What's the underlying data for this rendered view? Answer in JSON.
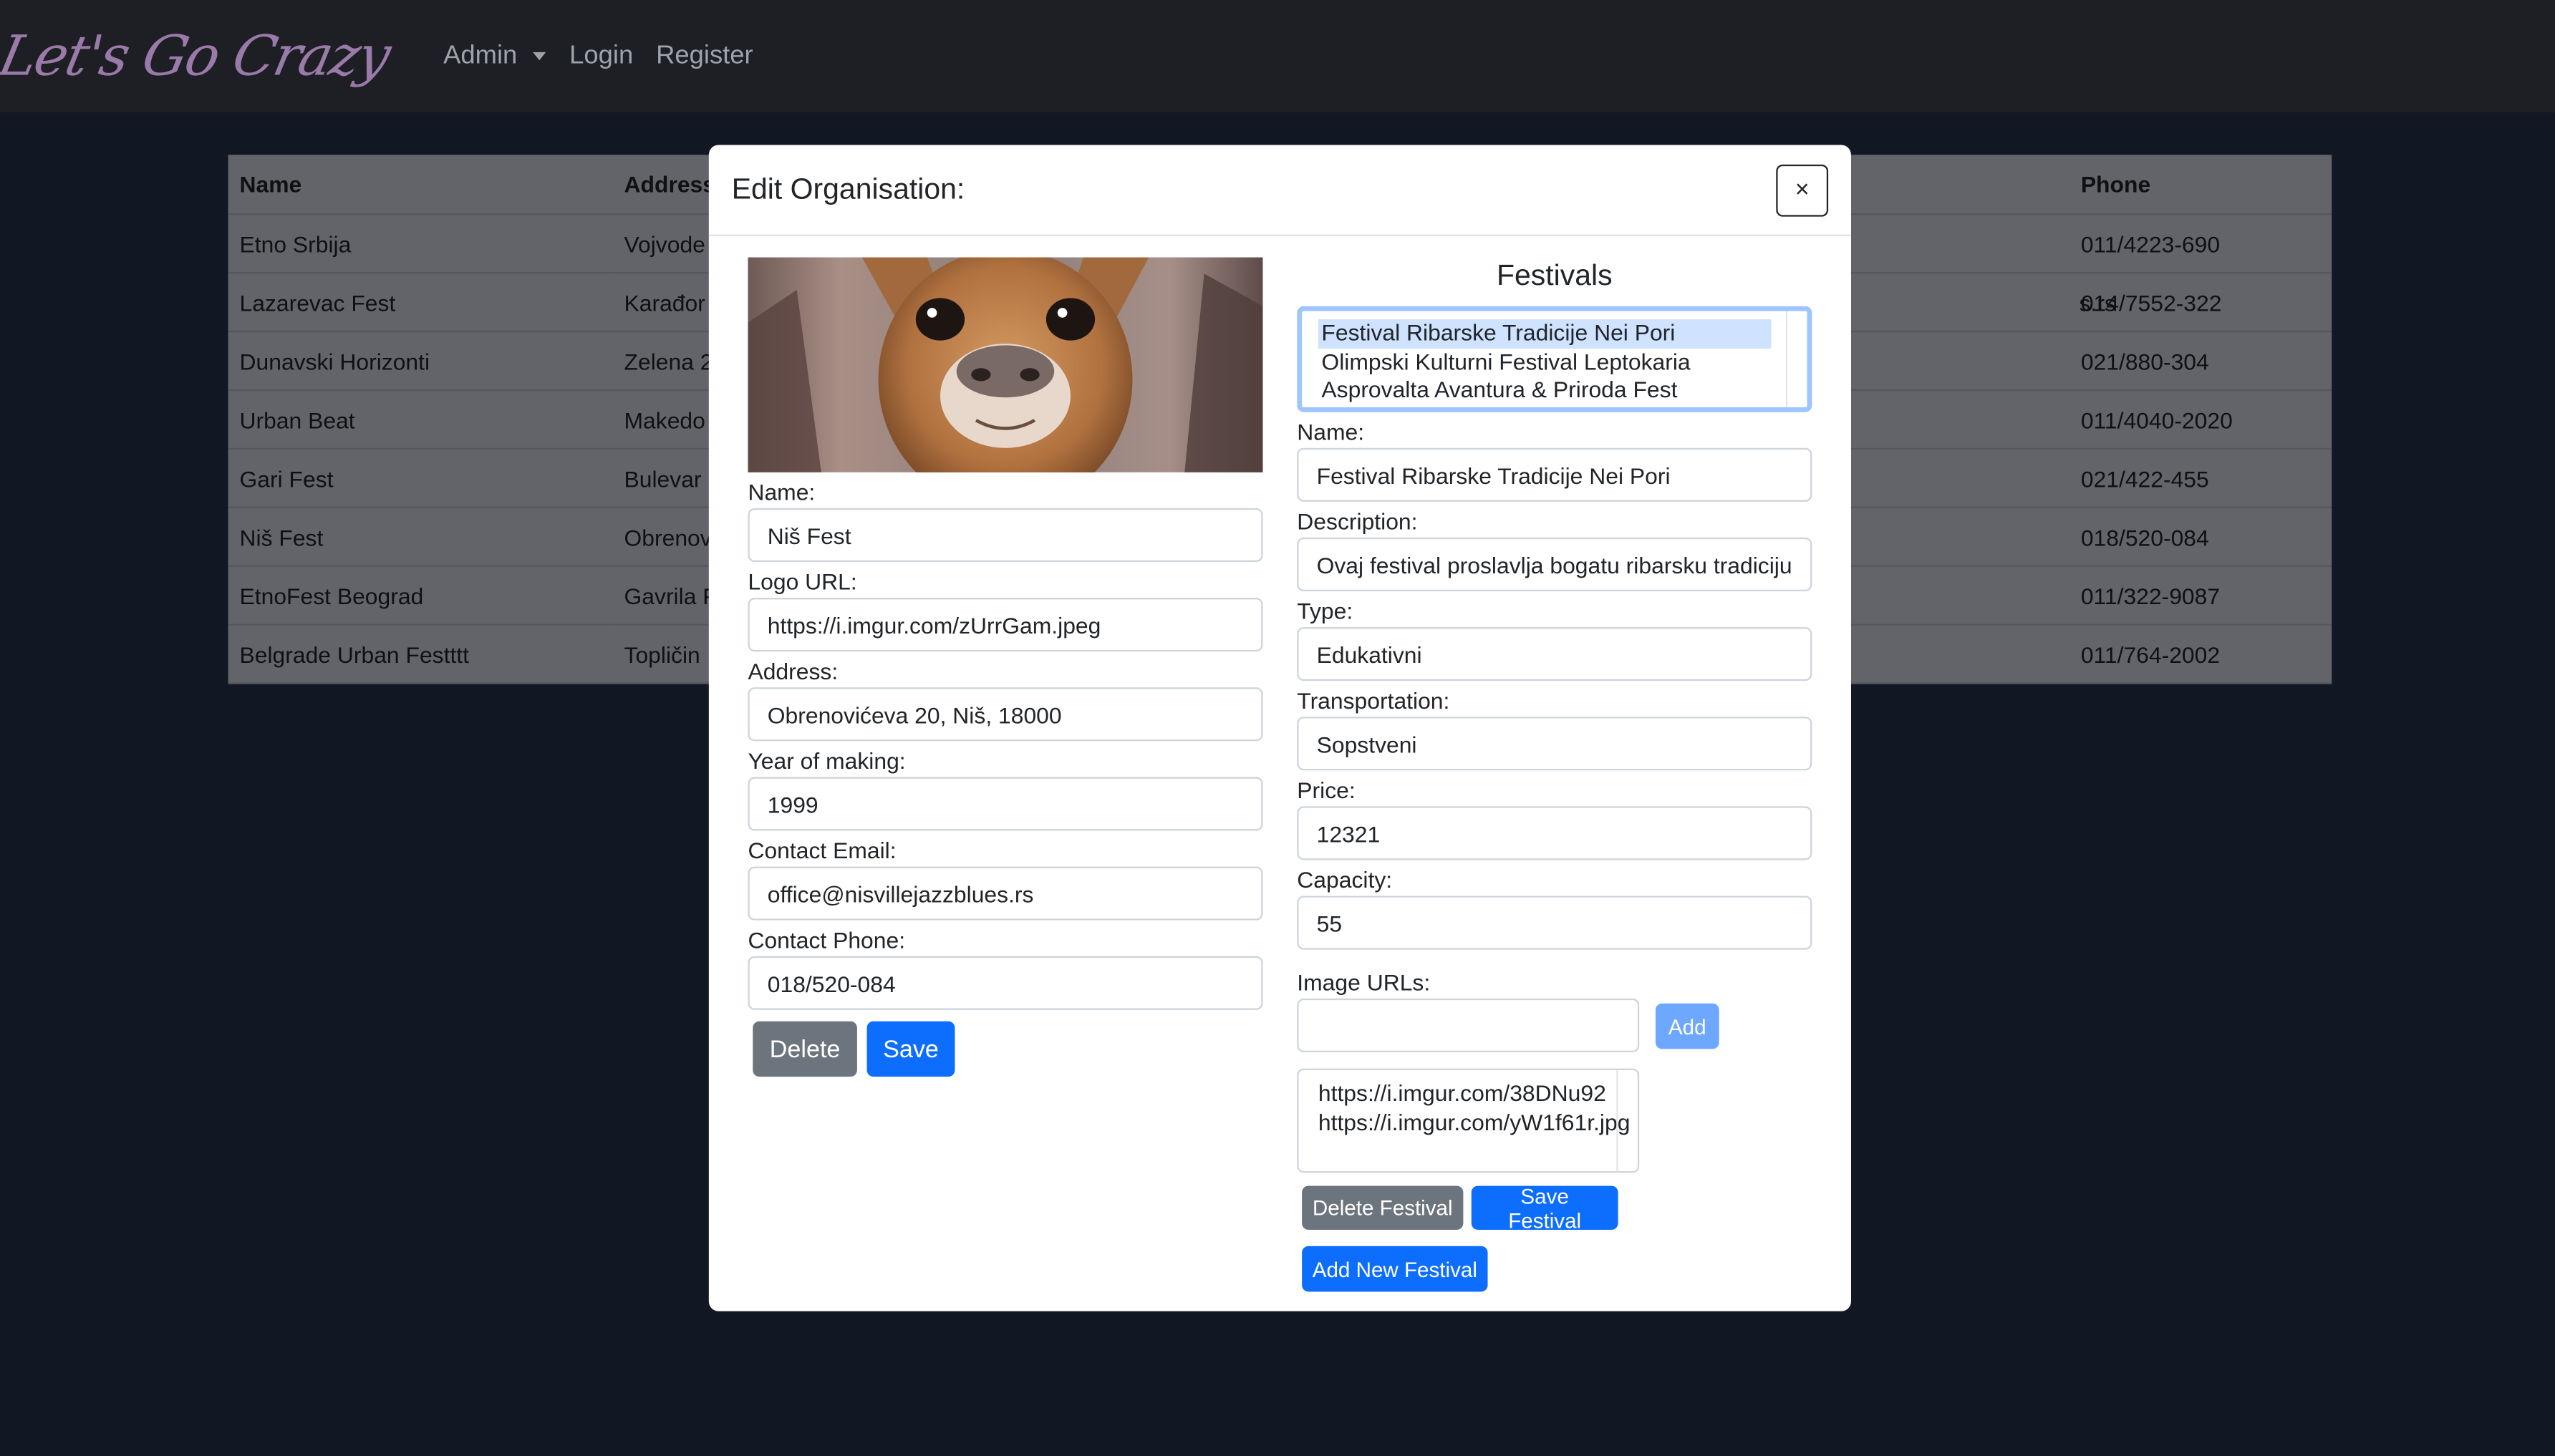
{
  "navbar": {
    "brand": "Let's Go Crazy",
    "admin_label": "Admin",
    "login_label": "Login",
    "register_label": "Register"
  },
  "table": {
    "headers": [
      "Name",
      "Address",
      "Phone"
    ],
    "rows": [
      {
        "name": "Etno Srbija",
        "address": "Vojvode",
        "extra": "",
        "phone": "011/4223-690"
      },
      {
        "name": "Lazarevac Fest",
        "address": "Karađor",
        "extra": "s.rs",
        "phone": "014/7552-322"
      },
      {
        "name": "Dunavski Horizonti",
        "address": "Zelena 2",
        "extra": "",
        "phone": "021/880-304"
      },
      {
        "name": "Urban Beat",
        "address": "Makedo",
        "extra": "",
        "phone": "011/4040-2020"
      },
      {
        "name": "Gari Fest",
        "address": "Bulevar",
        "extra": "",
        "phone": "021/422-455"
      },
      {
        "name": "Niš Fest",
        "address": "Obrenov",
        "extra": "",
        "phone": "018/520-084"
      },
      {
        "name": "EtnoFest Beograd",
        "address": "Gavrila P",
        "extra": "",
        "phone": "011/322-9087"
      },
      {
        "name": "Belgrade Urban Festttt",
        "address": "Topličin",
        "extra": "",
        "phone": "011/764-2002"
      }
    ]
  },
  "modal": {
    "title": "Edit Organisation:",
    "close_label": "×",
    "org": {
      "name_label": "Name:",
      "name_value": "Niš Fest",
      "logo_label": "Logo URL:",
      "logo_value": "https://i.imgur.com/zUrrGam.jpeg",
      "address_label": "Address:",
      "address_value": "Obrenovićeva 20, Niš, 18000",
      "year_label": "Year of making:",
      "year_value": "1999",
      "email_label": "Contact Email:",
      "email_value": "office@nisvillejazzblues.rs",
      "phone_label": "Contact Phone:",
      "phone_value": "018/520-084",
      "delete_label": "Delete",
      "save_label": "Save"
    },
    "festivals": {
      "title": "Festivals",
      "options": [
        "Festival Ribarske Tradicije Nei Pori",
        "Olimpski Kulturni Festival Leptokaria",
        "Asprovalta Avantura & Priroda Fest"
      ],
      "name_label": "Name:",
      "name_value": "Festival Ribarske Tradicije Nei Pori",
      "description_label": "Description:",
      "description_value": "Ovaj festival proslavlja bogatu ribarsku tradiciju",
      "type_label": "Type:",
      "type_value": "Edukativni",
      "transportation_label": "Transportation:",
      "transportation_value": "Sopstveni",
      "price_label": "Price:",
      "price_value": "12321",
      "capacity_label": "Capacity:",
      "capacity_value": "55",
      "image_urls_label": "Image URLs:",
      "image_url_input": "",
      "add_label": "Add",
      "image_urls": [
        "https://i.imgur.com/38DNu92",
        "https://i.imgur.com/yW1f61r.jpg"
      ],
      "delete_festival_label": "Delete Festival",
      "save_festival_label": "Save Festival",
      "add_new_festival_label": "Add New Festival"
    }
  }
}
